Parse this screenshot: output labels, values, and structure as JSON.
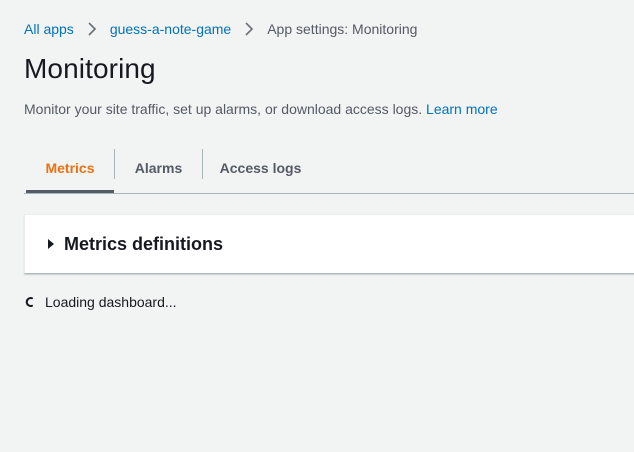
{
  "breadcrumb": {
    "items": [
      {
        "label": "All apps"
      },
      {
        "label": "guess-a-note-game"
      },
      {
        "label": "App settings: Monitoring"
      }
    ]
  },
  "page": {
    "title": "Monitoring",
    "description": "Monitor your site traffic, set up alarms, or download access logs.",
    "learn_more": "Learn more"
  },
  "tabs": [
    {
      "label": "Metrics",
      "active": true
    },
    {
      "label": "Alarms",
      "active": false
    },
    {
      "label": "Access logs",
      "active": false
    }
  ],
  "metrics_panel": {
    "title": "Metrics definitions",
    "icon": "caret-right-icon"
  },
  "status": {
    "loading_text": "Loading dashboard...",
    "icon": "spinner-icon"
  },
  "colors": {
    "link": "#0073bb",
    "active_tab": "#ec7211",
    "background": "#f2f3f3"
  }
}
